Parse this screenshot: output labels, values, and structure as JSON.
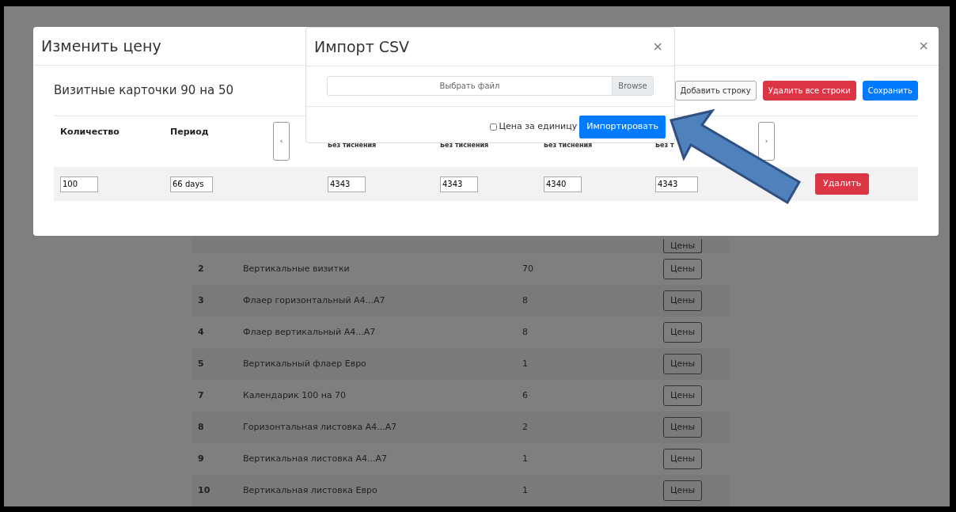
{
  "background_table": {
    "rows": [
      {
        "number": "",
        "name": "",
        "count": "",
        "button": "Цены"
      },
      {
        "number": "2",
        "name": "Вертикальные визитки",
        "count": "70",
        "button": "Цены"
      },
      {
        "number": "3",
        "name": "Флаер горизонтальный А4...А7",
        "count": "8",
        "button": "Цены"
      },
      {
        "number": "4",
        "name": "Флаер вертикальный А4...А7",
        "count": "8",
        "button": "Цены"
      },
      {
        "number": "5",
        "name": "Вертикальный флаер Евро",
        "count": "1",
        "button": "Цены"
      },
      {
        "number": "7",
        "name": "Календарик 100 на 70",
        "count": "6",
        "button": "Цены"
      },
      {
        "number": "8",
        "name": "Горизонтальная листовка А4...А7",
        "count": "2",
        "button": "Цены"
      },
      {
        "number": "9",
        "name": "Вертикальная листовка А4...А7",
        "count": "1",
        "button": "Цены"
      },
      {
        "number": "10",
        "name": "Вертикальная листовка Евро",
        "count": "1",
        "button": "Цены"
      }
    ]
  },
  "price_modal": {
    "title": "Изменить цену",
    "close": "×",
    "product": "Визитные карточки 90 на 50",
    "buttons": [
      {
        "label": "Добавить строку",
        "kind": "light"
      },
      {
        "label": "Удалить все строки",
        "kind": "danger"
      },
      {
        "label": "Сохранить",
        "kind": "primary"
      }
    ],
    "columns": [
      {
        "label": "Количество"
      },
      {
        "label": "Период"
      }
    ],
    "prev": "‹",
    "next": "›",
    "price_columns": [
      "Без тиснения",
      "Без тиснения",
      "Без тиснения",
      "Без т"
    ],
    "row": {
      "quantity": "100",
      "period": "66 days",
      "prices": [
        "4343",
        "4343",
        "4340",
        "4343"
      ],
      "delete": "Удалить"
    }
  },
  "import_modal": {
    "title": "Импорт CSV",
    "close": "×",
    "file_placeholder": "Выбрать файл",
    "browse": "Browse",
    "unit_price": {
      "label": "Цена за единицу",
      "checked": false
    },
    "import_button": "Импортировать"
  }
}
